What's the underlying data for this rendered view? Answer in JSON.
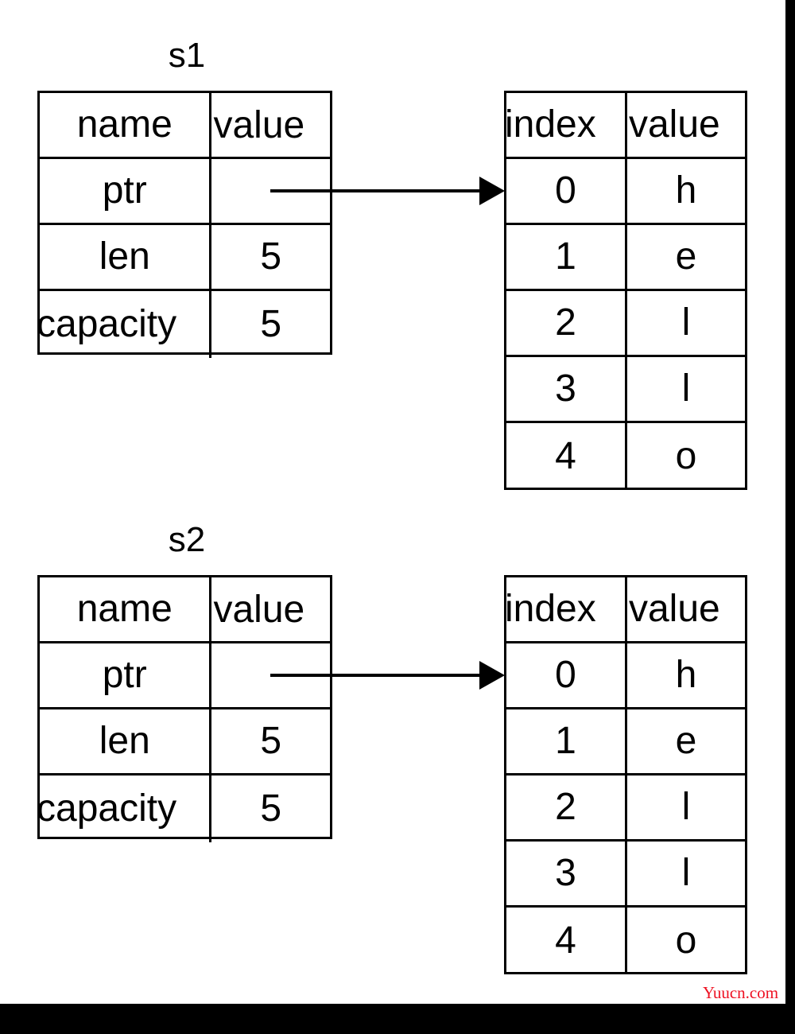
{
  "diagram": {
    "type": "memory-layout",
    "groups": [
      {
        "title": "s1",
        "struct_table": {
          "headers": [
            "name",
            "value"
          ],
          "rows": [
            {
              "name": "ptr",
              "value": ""
            },
            {
              "name": "len",
              "value": "5"
            },
            {
              "name": "capacity",
              "value": "5"
            }
          ]
        },
        "array_table": {
          "headers": [
            "index",
            "value"
          ],
          "rows": [
            {
              "index": "0",
              "value": "h"
            },
            {
              "index": "1",
              "value": "e"
            },
            {
              "index": "2",
              "value": "l"
            },
            {
              "index": "3",
              "value": "l"
            },
            {
              "index": "4",
              "value": "o"
            }
          ]
        },
        "pointer_arrow": "ptr-to-array-arrow"
      },
      {
        "title": "s2",
        "struct_table": {
          "headers": [
            "name",
            "value"
          ],
          "rows": [
            {
              "name": "ptr",
              "value": ""
            },
            {
              "name": "len",
              "value": "5"
            },
            {
              "name": "capacity",
              "value": "5"
            }
          ]
        },
        "array_table": {
          "headers": [
            "index",
            "value"
          ],
          "rows": [
            {
              "index": "0",
              "value": "h"
            },
            {
              "index": "1",
              "value": "e"
            },
            {
              "index": "2",
              "value": "l"
            },
            {
              "index": "3",
              "value": "l"
            },
            {
              "index": "4",
              "value": "o"
            }
          ]
        },
        "pointer_arrow": "ptr-to-array-arrow"
      }
    ]
  },
  "watermark": {
    "text": "Yuucn.com",
    "color": "#ee1122"
  },
  "colors": {
    "stroke": "#000000",
    "background": "#ffffff",
    "band": "#000000"
  }
}
